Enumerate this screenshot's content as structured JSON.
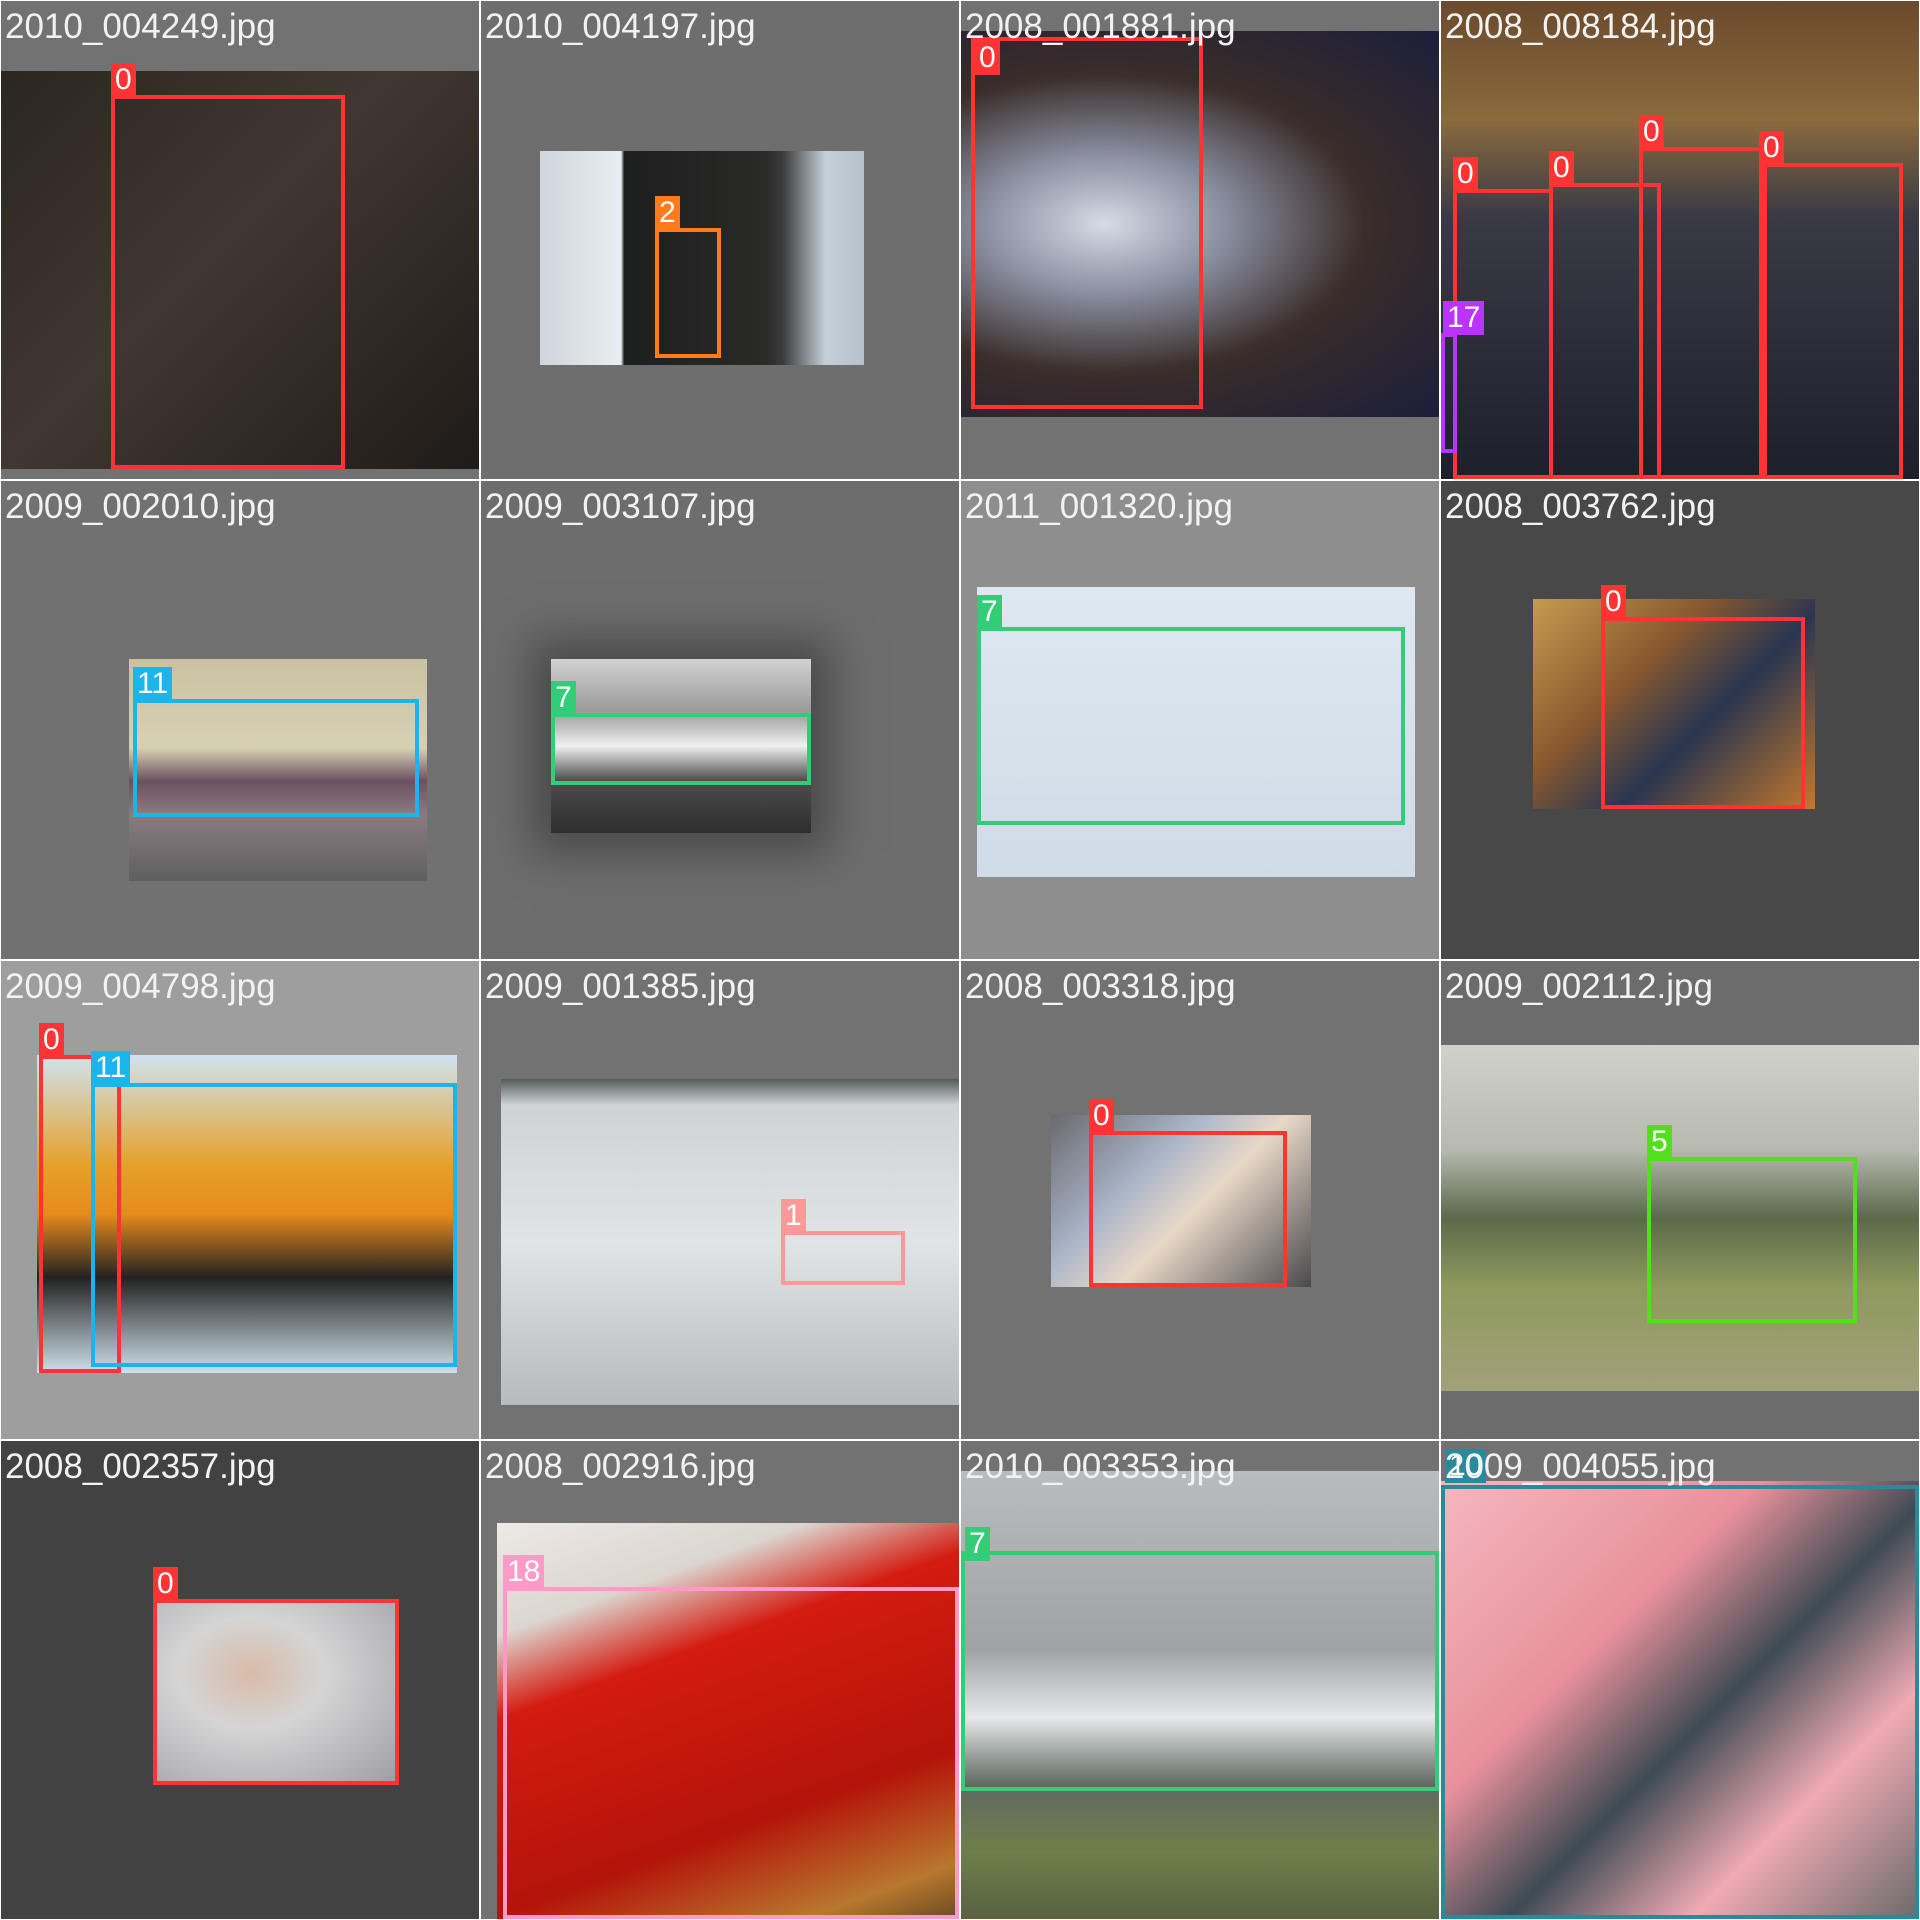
{
  "colors": {
    "0": "#ff3333",
    "1": "#ff9999",
    "2": "#ff7a1a",
    "5": "#52e01c",
    "7": "#33cc77",
    "10": "#2a8a9a",
    "11": "#1ab5ea",
    "17": "#bb33ff",
    "18": "#ff99c8"
  },
  "tiles": [
    {
      "filename": "2010_004249.jpg",
      "boxes": [
        {
          "label": "0"
        }
      ]
    },
    {
      "filename": "2010_004197.jpg",
      "boxes": [
        {
          "label": "2"
        }
      ]
    },
    {
      "filename": "2008_001881.jpg",
      "boxes": [
        {
          "label": "0"
        }
      ]
    },
    {
      "filename": "2008_008184.jpg",
      "boxes": [
        {
          "label": "0"
        },
        {
          "label": "0"
        },
        {
          "label": "0"
        },
        {
          "label": "0"
        },
        {
          "label": "17"
        }
      ]
    },
    {
      "filename": "2009_002010.jpg",
      "boxes": [
        {
          "label": "11"
        }
      ]
    },
    {
      "filename": "2009_003107.jpg",
      "boxes": [
        {
          "label": "7"
        }
      ]
    },
    {
      "filename": "2011_001320.jpg",
      "boxes": [
        {
          "label": "7"
        }
      ]
    },
    {
      "filename": "2008_003762.jpg",
      "boxes": [
        {
          "label": "0"
        }
      ]
    },
    {
      "filename": "2009_004798.jpg",
      "boxes": [
        {
          "label": "0"
        },
        {
          "label": "11"
        }
      ]
    },
    {
      "filename": "2009_001385.jpg",
      "boxes": [
        {
          "label": "1"
        }
      ]
    },
    {
      "filename": "2008_003318.jpg",
      "boxes": [
        {
          "label": "0"
        }
      ]
    },
    {
      "filename": "2009_002112.jpg",
      "boxes": [
        {
          "label": "5"
        }
      ]
    },
    {
      "filename": "2008_002357.jpg",
      "boxes": [
        {
          "label": "0"
        }
      ]
    },
    {
      "filename": "2008_002916.jpg",
      "boxes": [
        {
          "label": "18"
        }
      ]
    },
    {
      "filename": "2010_003353.jpg",
      "boxes": [
        {
          "label": "7"
        }
      ]
    },
    {
      "filename": "2009_004055.jpg",
      "boxes": [
        {
          "label": "10"
        }
      ]
    }
  ]
}
